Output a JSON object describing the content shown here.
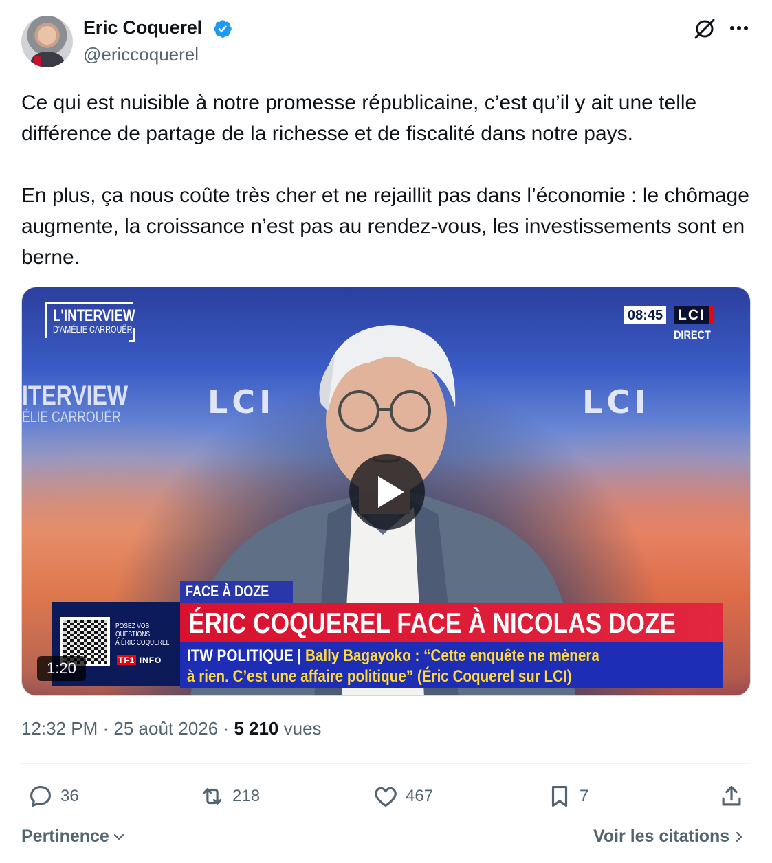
{
  "author": {
    "name": "Eric Coquerel",
    "handle": "@ericcoquerel",
    "verified_icon": "verified-badge-icon"
  },
  "tweet": {
    "paragraphs": [
      "Ce qui est nuisible à notre promesse républicaine, c’est qu’il y ait une telle différence de partage de la richesse et de fiscalité dans notre pays.",
      "En plus, ça nous coûte très cher et ne rejaillit pas dans l’économie : le chômage augmente, la croissance n’est pas au rendez-vous, les investissements sont en berne."
    ]
  },
  "video": {
    "interview_logo_line1": "L'INTERVIEW",
    "interview_logo_line2": "D'AMÉLIE CARROUËR",
    "bg_interview": "ITERVIEW",
    "bg_interview_sub": "ÉLIE CARROUËR",
    "bg_lci": "LCI",
    "clock": "08:45",
    "channel": "LCI",
    "direct": "DIRECT",
    "tag": "FACE À DOZE",
    "headline": "ÉRIC COQUEREL FACE À NICOLAS DOZE",
    "sub_prefix": "ITW POLITIQUE |",
    "sub_line1": " Bally Bagayoko : “Cette enquête ne mènera",
    "sub_line2": "à rien. C’est une affaire politique” (Éric Coquerel sur LCI)",
    "qr_text": [
      "POSEZ VOS",
      "QUESTIONS",
      "À ÉRIC COQUEREL"
    ],
    "tf1_logo": "TF1",
    "tf1_suffix": "INFO",
    "duration": "1:20"
  },
  "meta": {
    "time": "12:32 PM",
    "sep1": " · ",
    "date": "25 août 2026",
    "sep2": " · ",
    "views_count": "5 210",
    "views_label": " vues"
  },
  "actions": {
    "replies": "36",
    "reposts": "218",
    "likes": "467",
    "bookmarks": "7"
  },
  "footer": {
    "sort_label": "Pertinence",
    "quotes_label": "Voir les citations"
  }
}
